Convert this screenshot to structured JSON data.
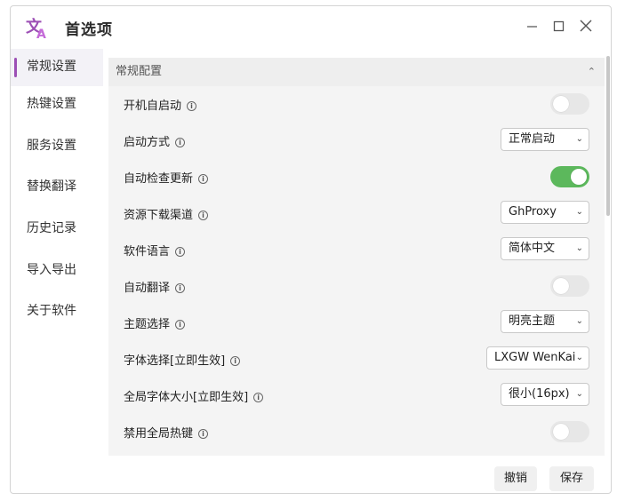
{
  "window": {
    "title": "首选项",
    "controls": {
      "minimize_icon": "minimize-icon",
      "maximize_icon": "maximize-icon",
      "close_icon": "close-icon"
    },
    "accent_color": "#9c4fb5"
  },
  "sidebar": {
    "items": [
      {
        "label": "常规设置",
        "active": true
      },
      {
        "label": "热键设置"
      },
      {
        "label": "服务设置"
      },
      {
        "label": "替换翻译"
      },
      {
        "label": "历史记录"
      },
      {
        "label": "导入导出"
      },
      {
        "label": "关于软件"
      }
    ]
  },
  "section": {
    "title": "常规配置",
    "collapse_icon": "chevron-up-icon"
  },
  "settings": [
    {
      "label": "开机自启动",
      "type": "toggle",
      "value": false
    },
    {
      "label": "启动方式",
      "type": "select",
      "value": "正常启动"
    },
    {
      "label": "自动检查更新",
      "type": "toggle",
      "value": true
    },
    {
      "label": "资源下载渠道",
      "type": "select",
      "value": "GhProxy"
    },
    {
      "label": "软件语言",
      "type": "select",
      "value": "简体中文"
    },
    {
      "label": "自动翻译",
      "type": "toggle",
      "value": false
    },
    {
      "label": "主题选择",
      "type": "select",
      "value": "明亮主题"
    },
    {
      "label": "字体选择[立即生效]",
      "type": "select",
      "value": "LXGW WenKai"
    },
    {
      "label": "全局字体大小[立即生效]",
      "type": "select",
      "value": "很小(16px)"
    },
    {
      "label": "禁用全局热键",
      "type": "toggle",
      "value": false
    }
  ],
  "info_icon": "info-icon",
  "info_glyph": "i",
  "chevron_glyph": "⌄",
  "toggle_on_color": "#5cb85c",
  "footer": {
    "cancel_label": "撤销",
    "save_label": "保存"
  }
}
